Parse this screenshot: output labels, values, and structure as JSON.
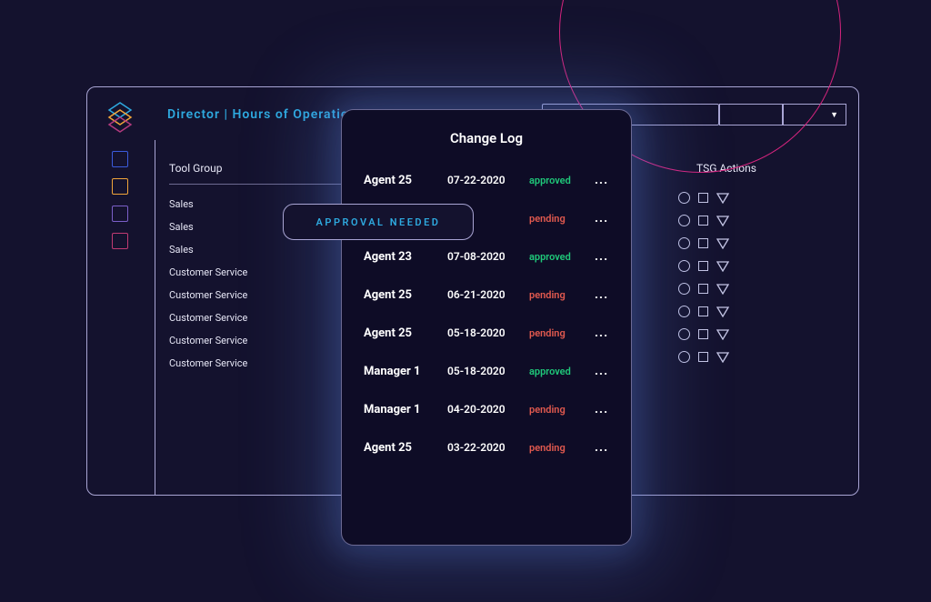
{
  "header": {
    "title": "Director | Hours of Operations",
    "dropdown_caret": "▼"
  },
  "tool_group": {
    "label": "Tool Group",
    "items": [
      "Sales",
      "Sales",
      "Sales",
      "Customer Service",
      "Customer Service",
      "Customer Service",
      "Customer Service",
      "Customer Service"
    ]
  },
  "approval_pill": "APPROVAL NEEDED",
  "tsg": {
    "label": "TSG Actions",
    "row_count": 8
  },
  "change_log": {
    "title": "Change Log",
    "rows": [
      {
        "agent": "Agent 25",
        "date": "07-22-2020",
        "status": "approved"
      },
      {
        "agent": "",
        "date": "",
        "status": "pending"
      },
      {
        "agent": "Agent 23",
        "date": "07-08-2020",
        "status": "approved"
      },
      {
        "agent": "Agent 25",
        "date": "06-21-2020",
        "status": "pending"
      },
      {
        "agent": "Agent 25",
        "date": "05-18-2020",
        "status": "pending"
      },
      {
        "agent": "Manager 1",
        "date": "05-18-2020",
        "status": "approved"
      },
      {
        "agent": "Manager 1",
        "date": "04-20-2020",
        "status": "pending"
      },
      {
        "agent": "Agent 25",
        "date": "03-22-2020",
        "status": "pending"
      }
    ],
    "more_glyph": "..."
  },
  "sidebar_colors": {
    "sq1": "#3b5bdc",
    "sq2": "#f0a43a",
    "sq3": "#7b5fc8",
    "sq4": "#c03a72"
  }
}
